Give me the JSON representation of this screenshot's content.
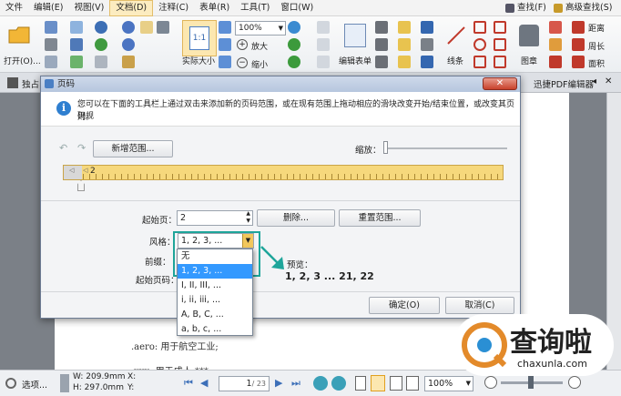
{
  "menubar": {
    "items": [
      "文件",
      "编辑(E)",
      "视图(V)",
      "文档(D)",
      "注释(C)",
      "表单(R)",
      "工具(T)",
      "窗口(W)"
    ],
    "active_index": 3,
    "find_label": "查找(F)",
    "adv_find_label": "高级查找(S)"
  },
  "ribbon": {
    "open_label": "打开(O)...",
    "actual_size_label": "实际大小",
    "zoom_value": "100%",
    "zoom_in_label": "放大",
    "zoom_out_label": "缩小",
    "edit_form_label": "编辑表单",
    "line_label": "线条",
    "stamp_label": "图章",
    "distance_label": "距离",
    "perimeter_label": "周长",
    "area_label": "面积"
  },
  "tabs": {
    "left_label": "独占",
    "right_label": "迅捷PDF编辑器"
  },
  "dialog": {
    "title": "页码",
    "close_label": "✕",
    "info_text_line1": "您可以在下面的工具栏上通过双击来添加新的页码范围，或在现有范围上拖动相应的滑块改变开始/结束位置，或改变其页码规",
    "info_text_line2": "则。",
    "new_range_label": "新增范围...",
    "zoom_label": "缩放：",
    "ruler_marker": "2",
    "start_page_label": "起始页：",
    "start_page_value": "2",
    "delete_label": "删除...",
    "reset_range_label": "重置范围...",
    "style_label": "风格：",
    "style_value": "1, 2, 3, ...",
    "prefix_label": "前缀：",
    "start_num_label": "起始页码：",
    "preview_label": "预览：",
    "preview_value": "1, 2, 3 ... 21, 22",
    "ok_label": "确定(O)",
    "cancel_label": "取消(C)"
  },
  "dropdown": {
    "options": [
      "无",
      "1, 2, 3, ...",
      "I, II, III, ...",
      "i, ii, iii, ...",
      "A, B, C, ...",
      "a, b, c, ..."
    ],
    "selected_index": 1
  },
  "document": {
    "line1": ".aero: 用于航空工业;",
    "line2": ".xxx: 用于成人 ***"
  },
  "statusbar": {
    "options_label": "选项...",
    "width_text": "W: 209.9mm",
    "height_text": "H: 297.0mm",
    "x_label": "X:",
    "y_label": "Y:",
    "page_value": "1",
    "page_total": "/ 23",
    "zoom_value": "100%"
  },
  "watermark": {
    "brand": "查询啦",
    "domain": "chaxunla.com"
  }
}
